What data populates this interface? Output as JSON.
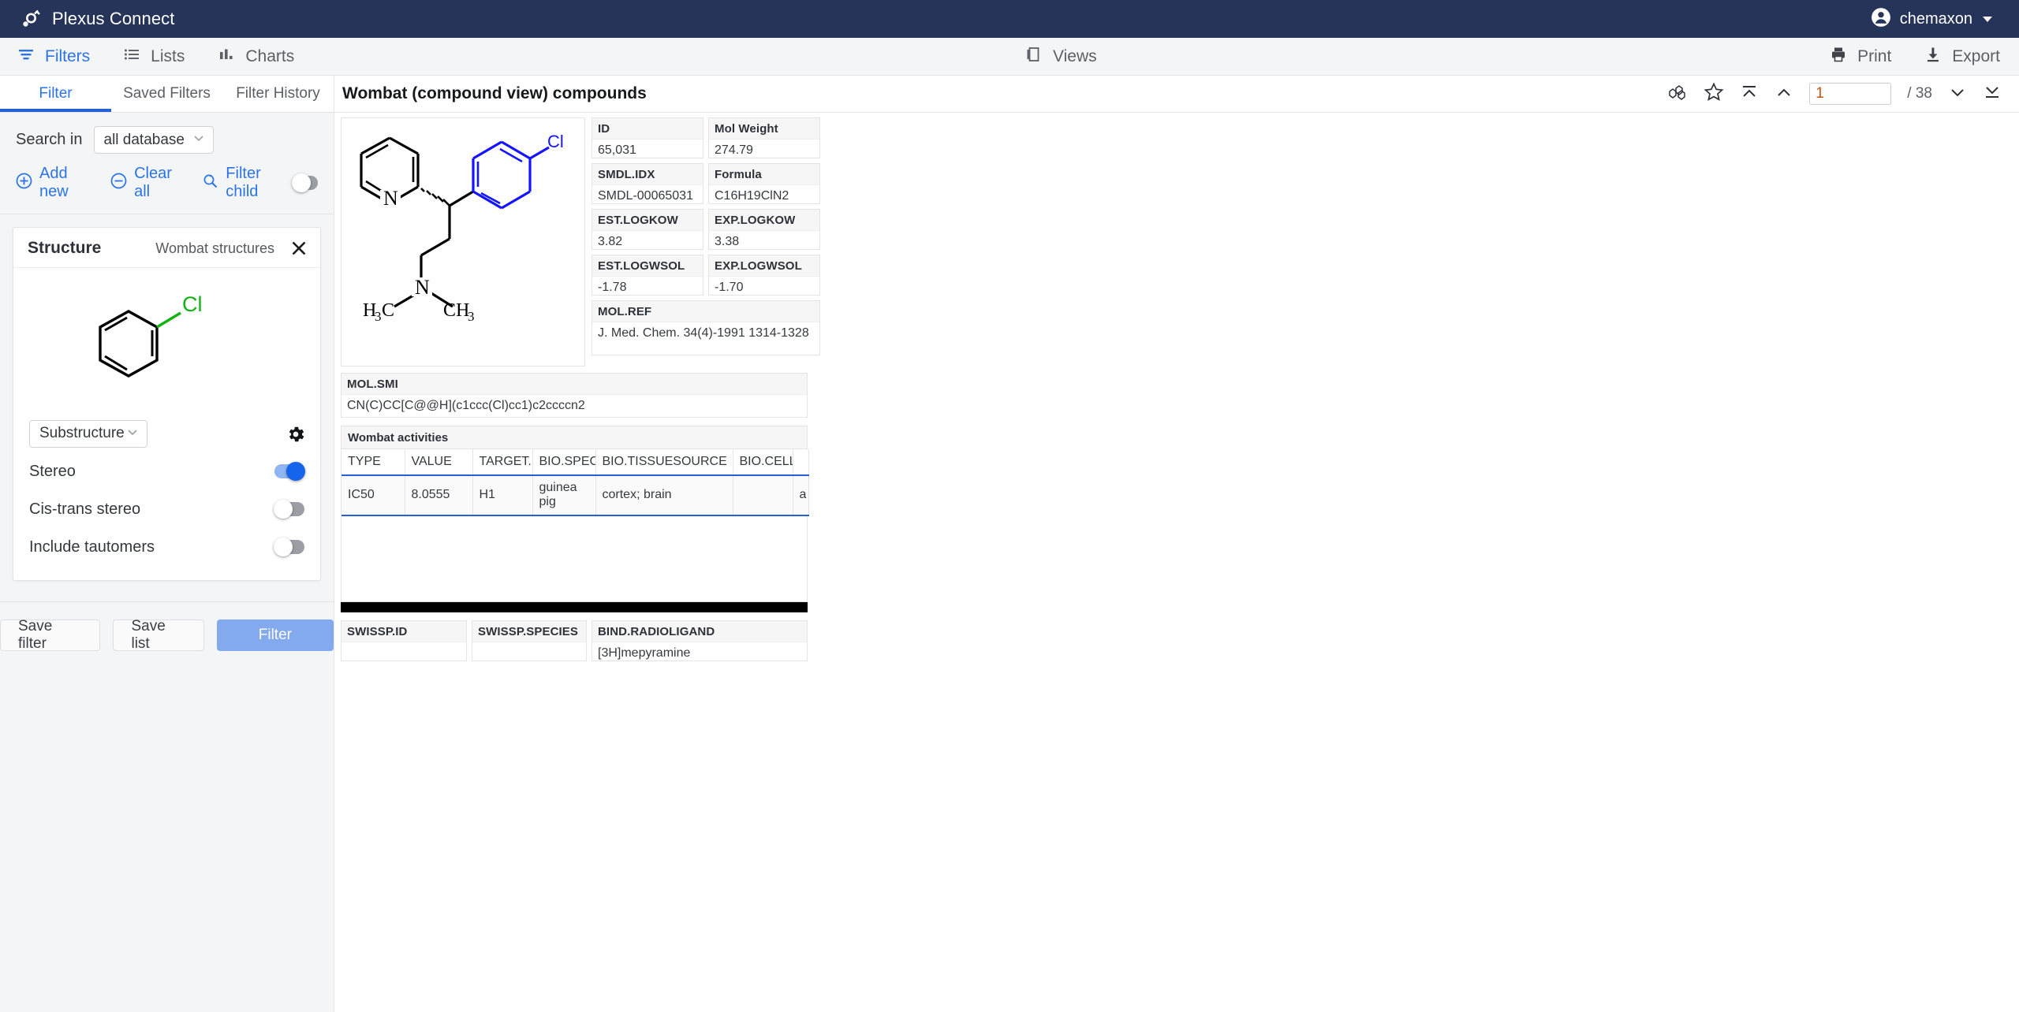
{
  "appbar": {
    "logo_icon": "plexus-logo-icon",
    "title": "Plexus Connect",
    "account_icon": "user-avatar-icon",
    "account_name": "chemaxon",
    "caret_icon": "chevron-down-icon"
  },
  "navbar": {
    "items": [
      {
        "label": "Filters",
        "icon": "filter-icon",
        "active": true
      },
      {
        "label": "Lists",
        "icon": "list-icon",
        "active": false
      },
      {
        "label": "Charts",
        "icon": "bar-chart-icon",
        "active": false
      }
    ],
    "views": {
      "label": "Views",
      "icon": "views-icon"
    },
    "print": {
      "label": "Print",
      "icon": "printer-icon"
    },
    "export": {
      "label": "Export",
      "icon": "download-icon"
    }
  },
  "filter_panel": {
    "tabs": [
      {
        "label": "Filter",
        "active": true
      },
      {
        "label": "Saved Filters",
        "active": false
      },
      {
        "label": "Filter History",
        "active": false
      }
    ],
    "search_in_label": "Search in",
    "search_in_value": "all database",
    "add_new_label": "Add new",
    "clear_all_label": "Clear all",
    "filter_child_label": "Filter child",
    "filter_child_on": false,
    "structure_card": {
      "title": "Structure",
      "subtitle": "Wombat structures",
      "close_icon": "close-icon",
      "sketch_atom_label": "Cl",
      "search_type": "Substructure",
      "settings_icon": "gear-icon",
      "options": [
        {
          "label": "Stereo",
          "on": true
        },
        {
          "label": "Cis-trans stereo",
          "on": false
        },
        {
          "label": "Include tautomers",
          "on": false
        }
      ]
    },
    "buttons": {
      "save_filter": "Save filter",
      "save_list": "Save list",
      "filter": "Filter"
    }
  },
  "content": {
    "title": "Wombat (compound view) compounds",
    "tools": {
      "structure_icon": "molecule-icon",
      "favorite_icon": "star-icon",
      "first_icon": "first-record-icon",
      "prev_icon": "previous-record-icon",
      "next_icon": "next-record-icon",
      "last_icon": "last-record-icon"
    },
    "pagination": {
      "current_page": "1",
      "separator": "/",
      "total_pages": "38"
    },
    "structure": {
      "alt": "chlorpheniramine-structure",
      "labels": {
        "ring_n": "N",
        "chloro": "Cl",
        "amine_n": "N",
        "methyl_left": "H3C",
        "methyl_right": "CH3"
      }
    },
    "fields": [
      {
        "name": "ID",
        "value": "65,031"
      },
      {
        "name": "Mol Weight",
        "value": "274.79"
      },
      {
        "name": "SMDL.IDX",
        "value": "SMDL-00065031"
      },
      {
        "name": "Formula",
        "value": "C16H19ClN2"
      },
      {
        "name": "EST.LOGKOW",
        "value": "3.82"
      },
      {
        "name": "EXP.LOGKOW",
        "value": "3.38"
      },
      {
        "name": "EST.LOGWSOL",
        "value": "-1.78"
      },
      {
        "name": "EXP.LOGWSOL",
        "value": "-1.70"
      }
    ],
    "mol_ref": {
      "name": "MOL.REF",
      "value": "J. Med. Chem. 34(4)-1991 1314-1328"
    },
    "mol_smi": {
      "name": "MOL.SMI",
      "value": "CN(C)CC[C@@H](c1ccc(Cl)cc1)c2ccccn2"
    },
    "activities": {
      "title": "Wombat activities",
      "columns": [
        "TYPE",
        "VALUE",
        "TARGET.NA",
        "BIO.SPECIE",
        "BIO.TISSUESOURCE",
        "BIO.CELL",
        ""
      ],
      "rows": [
        [
          "IC50",
          "8.0555",
          "H1",
          "guinea pig",
          "cortex; brain",
          "",
          "a"
        ]
      ]
    },
    "bottom_fields": [
      {
        "name": "SWISSP.ID",
        "value": ""
      },
      {
        "name": "SWISSP.SPECIES",
        "value": ""
      },
      {
        "name": "BIND.RADIOLIGAND",
        "value": "[3H]mepyramine"
      }
    ]
  }
}
